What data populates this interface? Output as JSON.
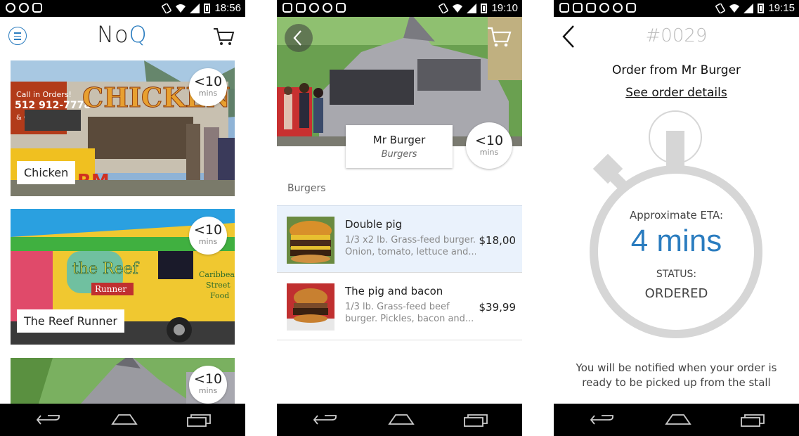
{
  "colors": {
    "accent": "#2a7cbf",
    "selected_row": "#eaf2fc",
    "status_bar": "#000000"
  },
  "screens": [
    {
      "status_bar": {
        "time": "18:56",
        "notification_icons": [
          "whatsapp-icon",
          "messenger-icon",
          "instagram-icon"
        ]
      },
      "header": {
        "logo_prefix": "No",
        "logo_suffix": "Q",
        "menu_icon": "menu-icon",
        "cart_icon": "cart-icon"
      },
      "stalls": [
        {
          "name": "Chicken",
          "eta_value": "<10",
          "eta_unit": "mins"
        },
        {
          "name": "The Reef Runner",
          "eta_value": "<10",
          "eta_unit": "mins"
        },
        {
          "name": "",
          "eta_value": "<10",
          "eta_unit": "mins"
        }
      ]
    },
    {
      "status_bar": {
        "time": "19:10",
        "notification_icons": [
          "instagram-icon",
          "gallery-icon",
          "whatsapp-icon",
          "messenger-icon",
          "instagram-icon"
        ]
      },
      "stall": {
        "name": "Mr Burger",
        "category": "Burgers",
        "eta_value": "<10",
        "eta_unit": "mins"
      },
      "section_title": "Burgers",
      "menu_items": [
        {
          "name": "Double pig",
          "desc_line1": "1/3 x2 lb. Grass-feed burger.",
          "desc_line2": "Onion, tomato, lettuce and...",
          "price": "$18,00"
        },
        {
          "name": "The pig and bacon",
          "desc_line1": "1/3 lb. Grass-feed beef",
          "desc_line2": "burger. Pickles, bacon and...",
          "price": "$39,99"
        }
      ]
    },
    {
      "status_bar": {
        "time": "19:15",
        "notification_icons": [
          "instagram-icon",
          "gallery-icon",
          "instagram-icon",
          "whatsapp-icon",
          "messenger-icon",
          "instagram-icon"
        ]
      },
      "order_number": "#0029",
      "order_from": "Order from Mr Burger",
      "details_link": "See order details",
      "eta_label": "Approximate ETA:",
      "eta_value": "4 mins",
      "status_label": "STATUS:",
      "status_value": "ORDERED",
      "notice_line1": "You will be notified when your order is",
      "notice_line2": "ready to be picked up from the stall"
    }
  ]
}
